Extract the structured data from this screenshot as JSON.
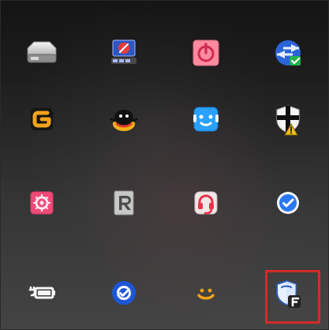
{
  "tray": {
    "title": "",
    "highlight_color": "#d32b2b",
    "icons": [
      {
        "name": "network-drive-icon"
      },
      {
        "name": "blocked-remote-connection-icon"
      },
      {
        "name": "power-shutdown-icon"
      },
      {
        "name": "network-transfer-verified-icon"
      },
      {
        "name": "g-app-icon"
      },
      {
        "name": "pet-mascot-icon"
      },
      {
        "name": "smiling-assistant-icon"
      },
      {
        "name": "security-warning-shield-icon"
      },
      {
        "name": "settings-gear-icon"
      },
      {
        "name": "r-app-icon"
      },
      {
        "name": "headset-support-icon"
      },
      {
        "name": "verified-check-icon"
      },
      {
        "name": "battery-power-icon"
      },
      {
        "name": "sync-check-icon"
      },
      {
        "name": "smile-icon"
      },
      {
        "name": "security-shield-f-icon",
        "selected": true
      }
    ]
  }
}
